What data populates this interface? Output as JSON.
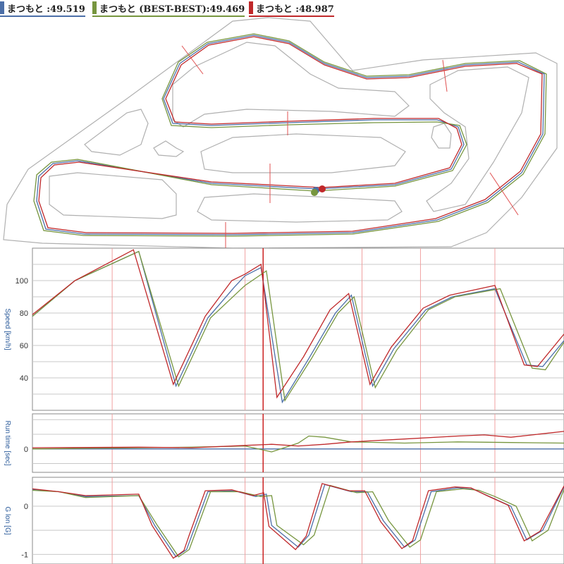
{
  "legend": [
    {
      "label": "まつもと :49.519",
      "color": "#4c6fa8"
    },
    {
      "label": "まつもと (BEST-BEST):49.469",
      "color": "#77963f"
    },
    {
      "label": "まつもと :48.987",
      "color": "#c0282a"
    }
  ],
  "colors": {
    "track_outline": "#b0b0b0",
    "grid": "#c8c8c8",
    "sector_line": "#f0a0a0",
    "cursor_line": "#cc2222"
  },
  "chart_data": [
    {
      "type": "line",
      "ylabel": "Speed [km/h]",
      "yticks": [
        40,
        60,
        80,
        100
      ],
      "ylim": [
        20,
        120
      ],
      "xlim": [
        0,
        1
      ],
      "sector_x": [
        0.15,
        0.4,
        0.62,
        0.73,
        0.87
      ],
      "cursor_x": 0.434,
      "series": [
        {
          "name": "まつもと :49.519",
          "color": "#4c6fa8",
          "x": [
            0,
            0.08,
            0.2,
            0.27,
            0.33,
            0.38,
            0.4,
            0.43,
            0.47,
            0.52,
            0.57,
            0.6,
            0.64,
            0.68,
            0.74,
            0.79,
            0.87,
            0.93,
            0.96,
            1.0
          ],
          "y": [
            78,
            100,
            118,
            35,
            77,
            96,
            103,
            108,
            25,
            52,
            80,
            91,
            35,
            58,
            82,
            90,
            95,
            48,
            47,
            63
          ]
        },
        {
          "name": "まつもと (BEST-BEST):49.469",
          "color": "#77963f",
          "x": [
            0,
            0.08,
            0.2,
            0.275,
            0.335,
            0.39,
            0.4,
            0.44,
            0.475,
            0.525,
            0.575,
            0.605,
            0.645,
            0.685,
            0.745,
            0.795,
            0.88,
            0.94,
            0.965,
            1.0
          ],
          "y": [
            78,
            100,
            118,
            35,
            77,
            94,
            97,
            106,
            26,
            52,
            80,
            90,
            34,
            57,
            82,
            90,
            95,
            46,
            45,
            62
          ]
        },
        {
          "name": "まつもと :48.987",
          "color": "#c0282a",
          "x": [
            0,
            0.08,
            0.19,
            0.265,
            0.325,
            0.375,
            0.4,
            0.43,
            0.46,
            0.51,
            0.56,
            0.595,
            0.635,
            0.675,
            0.735,
            0.785,
            0.87,
            0.925,
            0.95,
            1.0
          ],
          "y": [
            79,
            100,
            119,
            36,
            78,
            100,
            104,
            110,
            28,
            53,
            82,
            92,
            36,
            59,
            83,
            91,
            97,
            48,
            47,
            67
          ]
        }
      ]
    },
    {
      "type": "line",
      "ylabel": "Run time [sec]",
      "yticks": [
        0
      ],
      "ylim": [
        -0.4,
        0.6
      ],
      "xlim": [
        0,
        1
      ],
      "sector_x": [
        0.15,
        0.4,
        0.62,
        0.73,
        0.87
      ],
      "cursor_x": 0.434,
      "series": [
        {
          "name": "まつもと :49.519",
          "color": "#4c6fa8",
          "x": [
            0,
            0.2,
            0.4,
            0.5,
            0.6,
            0.8,
            1.0
          ],
          "y": [
            0,
            0,
            0,
            0,
            0,
            0,
            0
          ]
        },
        {
          "name": "まつもと (BEST-BEST):49.469",
          "color": "#77963f",
          "x": [
            0,
            0.2,
            0.3,
            0.4,
            0.45,
            0.5,
            0.52,
            0.55,
            0.6,
            0.7,
            0.8,
            0.9,
            1.0
          ],
          "y": [
            0,
            0.02,
            0.03,
            0.05,
            -0.05,
            0.1,
            0.22,
            0.2,
            0.12,
            0.1,
            0.12,
            0.11,
            0.1
          ]
        },
        {
          "name": "まつもと :48.987",
          "color": "#c0282a",
          "x": [
            0,
            0.2,
            0.3,
            0.4,
            0.45,
            0.5,
            0.55,
            0.6,
            0.7,
            0.8,
            0.85,
            0.9,
            1.0
          ],
          "y": [
            0.02,
            0.03,
            0.02,
            0.06,
            0.08,
            0.05,
            0.08,
            0.12,
            0.17,
            0.22,
            0.24,
            0.2,
            0.3
          ]
        }
      ]
    },
    {
      "type": "line",
      "ylabel": "G lon [G]",
      "yticks": [
        -1,
        0
      ],
      "ylim": [
        -1.2,
        0.6
      ],
      "xlim": [
        0,
        1
      ],
      "sector_x": [
        0.15,
        0.4,
        0.62,
        0.73,
        0.87
      ],
      "cursor_x": 0.434,
      "series": [
        {
          "name": "まつもと :49.519",
          "color": "#4c6fa8",
          "x": [
            0,
            0.05,
            0.1,
            0.2,
            0.23,
            0.27,
            0.29,
            0.3,
            0.33,
            0.38,
            0.42,
            0.44,
            0.45,
            0.5,
            0.52,
            0.55,
            0.6,
            0.63,
            0.66,
            0.7,
            0.72,
            0.75,
            0.8,
            0.83,
            0.86,
            0.9,
            0.93,
            0.96,
            1.0
          ],
          "y": [
            0.35,
            0.3,
            0.2,
            0.22,
            -0.4,
            -1.05,
            -0.9,
            -0.6,
            0.3,
            0.32,
            0.2,
            0.25,
            -0.4,
            -0.85,
            -0.6,
            0.45,
            0.3,
            0.3,
            -0.3,
            -0.85,
            -0.7,
            0.3,
            0.38,
            0.35,
            0.2,
            0.0,
            -0.7,
            -0.5,
            0.4
          ]
        },
        {
          "name": "まつもと (BEST-BEST):49.469",
          "color": "#77963f",
          "x": [
            0,
            0.05,
            0.1,
            0.2,
            0.235,
            0.275,
            0.295,
            0.305,
            0.335,
            0.39,
            0.43,
            0.45,
            0.46,
            0.51,
            0.53,
            0.56,
            0.61,
            0.64,
            0.67,
            0.71,
            0.73,
            0.76,
            0.81,
            0.84,
            0.87,
            0.91,
            0.94,
            0.97,
            1.0
          ],
          "y": [
            0.33,
            0.3,
            0.18,
            0.22,
            -0.4,
            -1.05,
            -0.9,
            -0.6,
            0.3,
            0.3,
            0.2,
            0.22,
            -0.4,
            -0.8,
            -0.6,
            0.43,
            0.28,
            0.3,
            -0.3,
            -0.85,
            -0.7,
            0.3,
            0.36,
            0.33,
            0.2,
            0.0,
            -0.72,
            -0.5,
            0.35
          ]
        },
        {
          "name": "まつもと :48.987",
          "color": "#c0282a",
          "x": [
            0,
            0.05,
            0.1,
            0.2,
            0.225,
            0.265,
            0.285,
            0.295,
            0.325,
            0.375,
            0.415,
            0.435,
            0.445,
            0.495,
            0.515,
            0.545,
            0.595,
            0.625,
            0.655,
            0.695,
            0.715,
            0.745,
            0.795,
            0.825,
            0.855,
            0.895,
            0.925,
            0.955,
            1.0
          ],
          "y": [
            0.36,
            0.3,
            0.22,
            0.25,
            -0.4,
            -1.08,
            -0.92,
            -0.6,
            0.32,
            0.34,
            0.22,
            0.28,
            -0.42,
            -0.9,
            -0.62,
            0.47,
            0.32,
            0.32,
            -0.32,
            -0.88,
            -0.72,
            0.32,
            0.4,
            0.38,
            0.22,
            0.02,
            -0.72,
            -0.52,
            0.42
          ]
        }
      ]
    }
  ]
}
